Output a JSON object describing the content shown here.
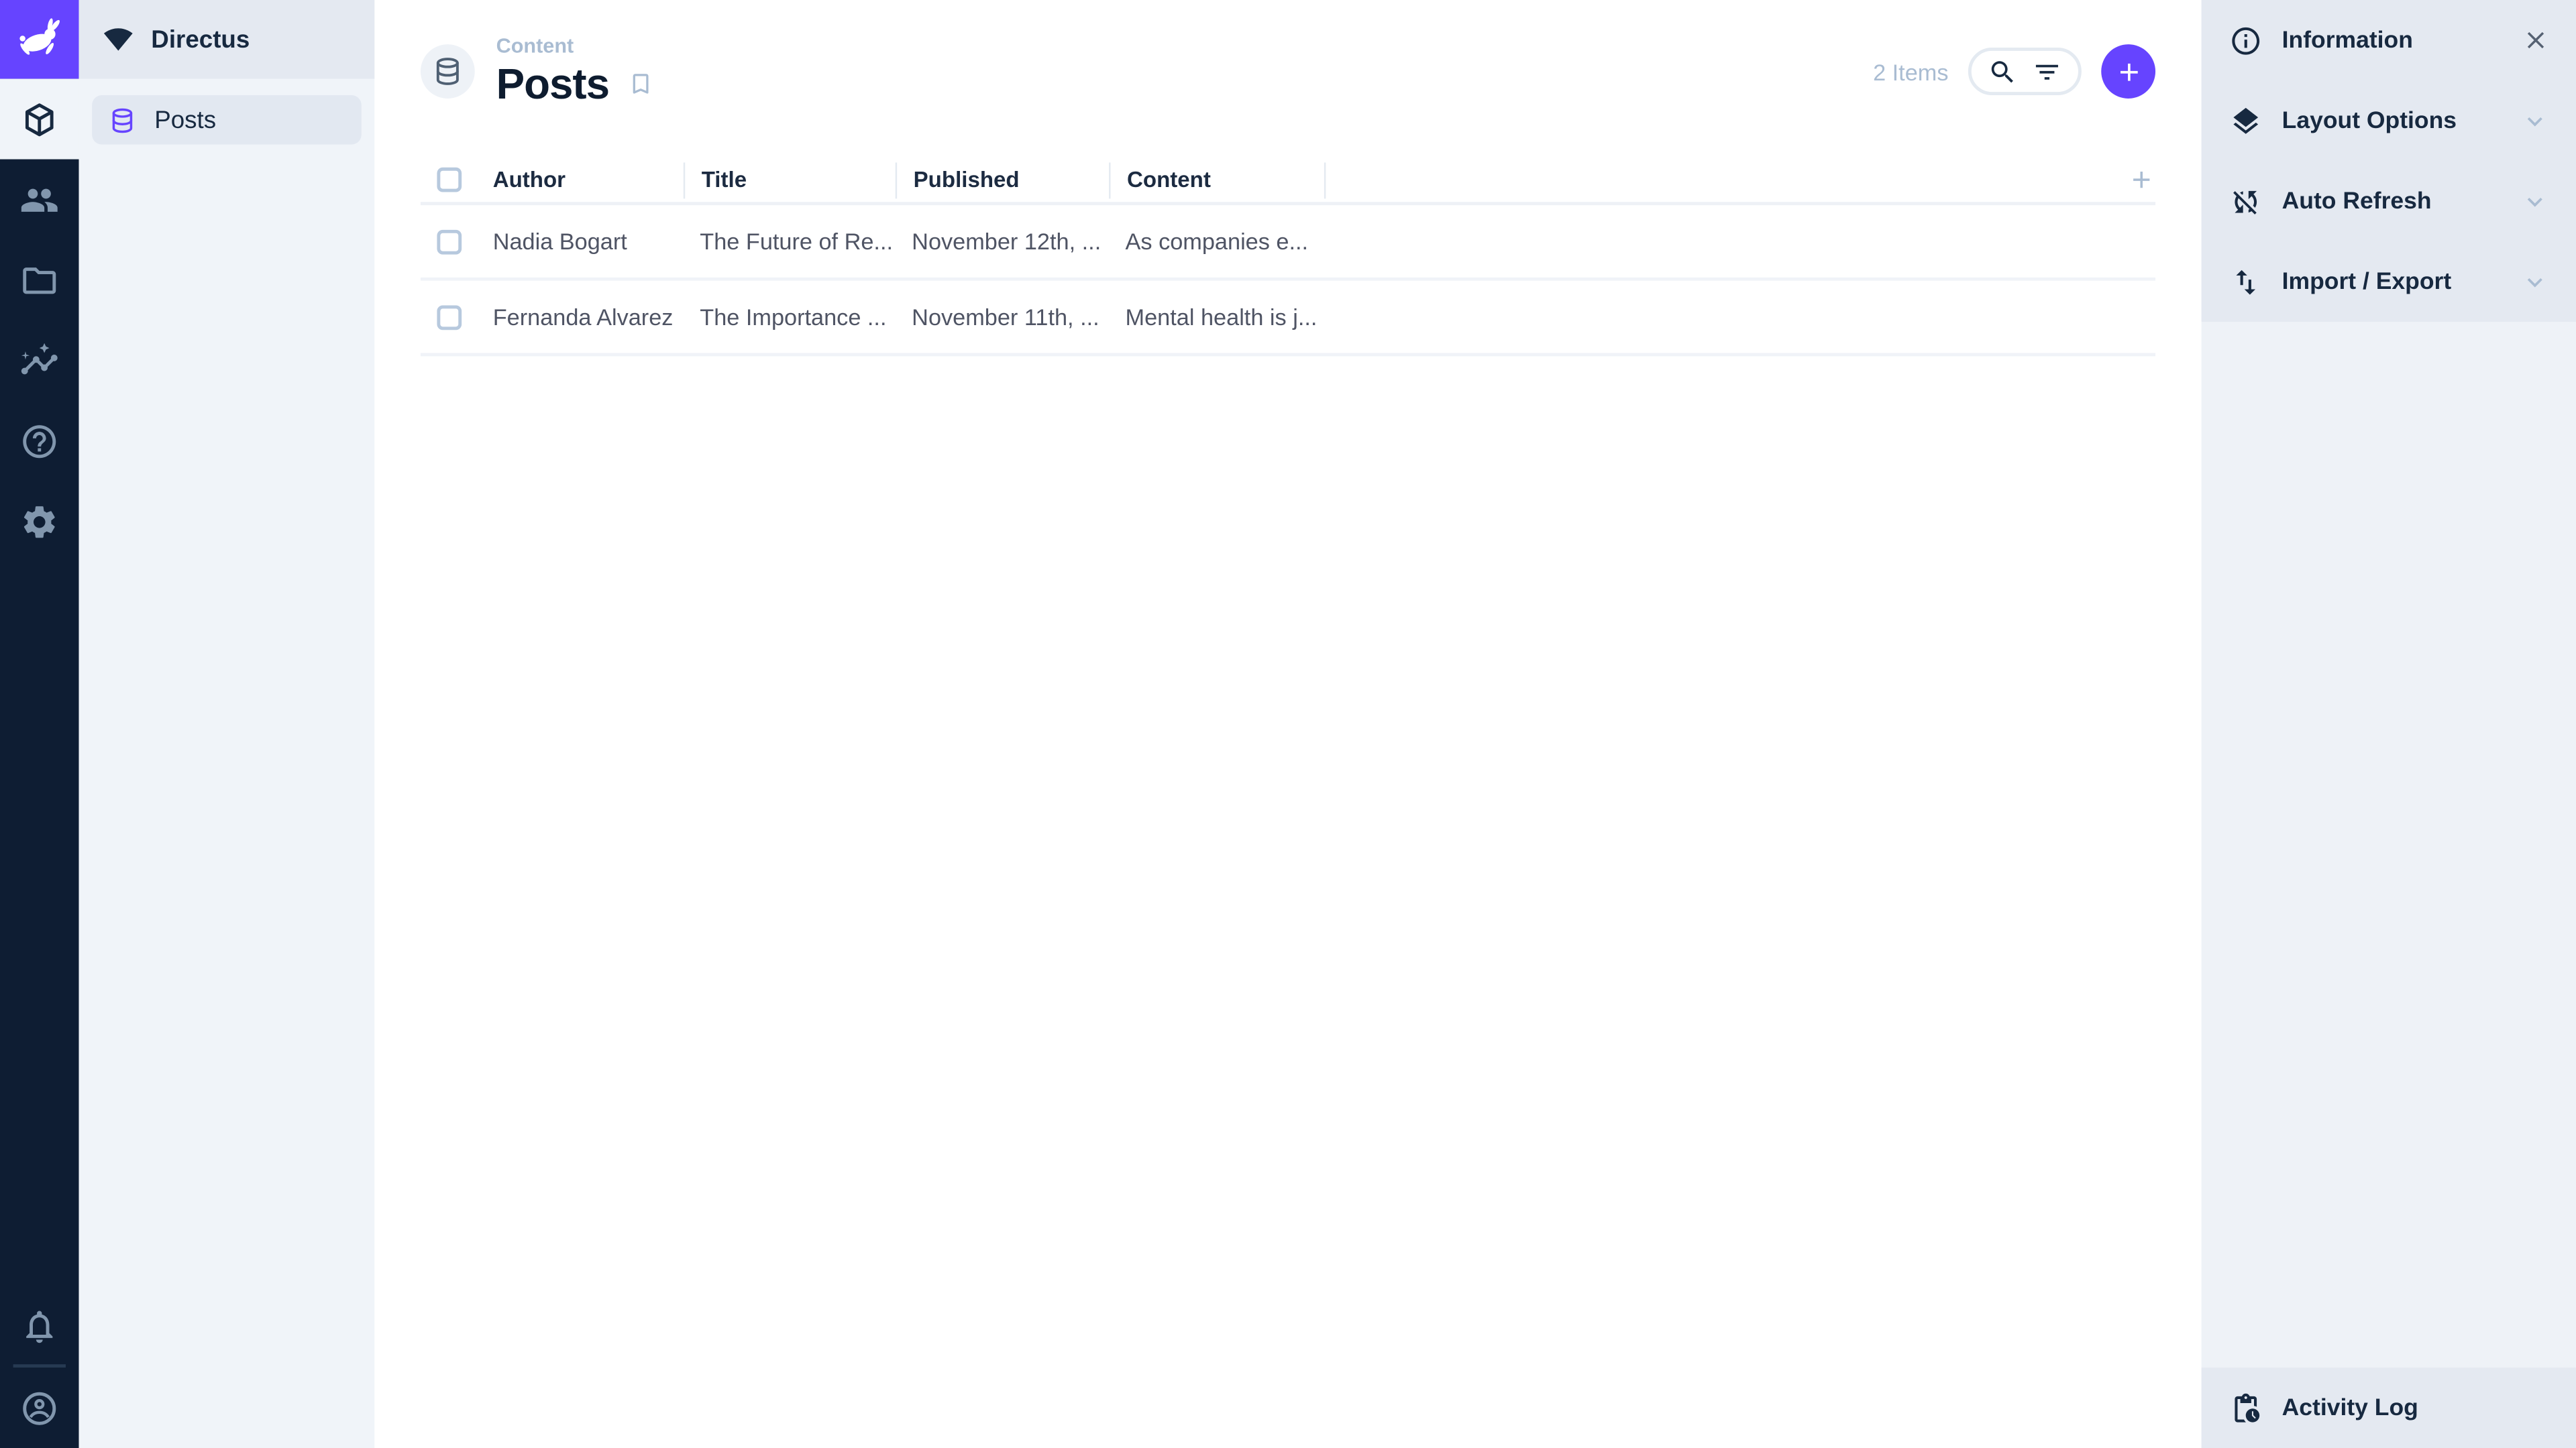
{
  "colors": {
    "accent": "#6644ff",
    "module_bar": "#0e1d33",
    "nav_background": "#f0f4f9",
    "sidebar_background": "#e4e9f1"
  },
  "nav": {
    "project_name": "Directus",
    "items": [
      {
        "label": "Posts",
        "active": true
      }
    ]
  },
  "header": {
    "breadcrumb": "Content",
    "title": "Posts",
    "items_count": "2 Items"
  },
  "table": {
    "columns": [
      "Author",
      "Title",
      "Published",
      "Content"
    ],
    "rows": [
      {
        "author": "Nadia Bogart",
        "title": "The Future of Re...",
        "published": "November 12th, ...",
        "content": "As companies e..."
      },
      {
        "author": "Fernanda Alvarez",
        "title": "The Importance ...",
        "published": "November 11th, ...",
        "content": "Mental health is j..."
      }
    ]
  },
  "sidebar": {
    "sections": [
      {
        "label": "Information"
      },
      {
        "label": "Layout Options"
      },
      {
        "label": "Auto Refresh"
      },
      {
        "label": "Import / Export"
      }
    ],
    "footer": {
      "label": "Activity Log"
    }
  }
}
